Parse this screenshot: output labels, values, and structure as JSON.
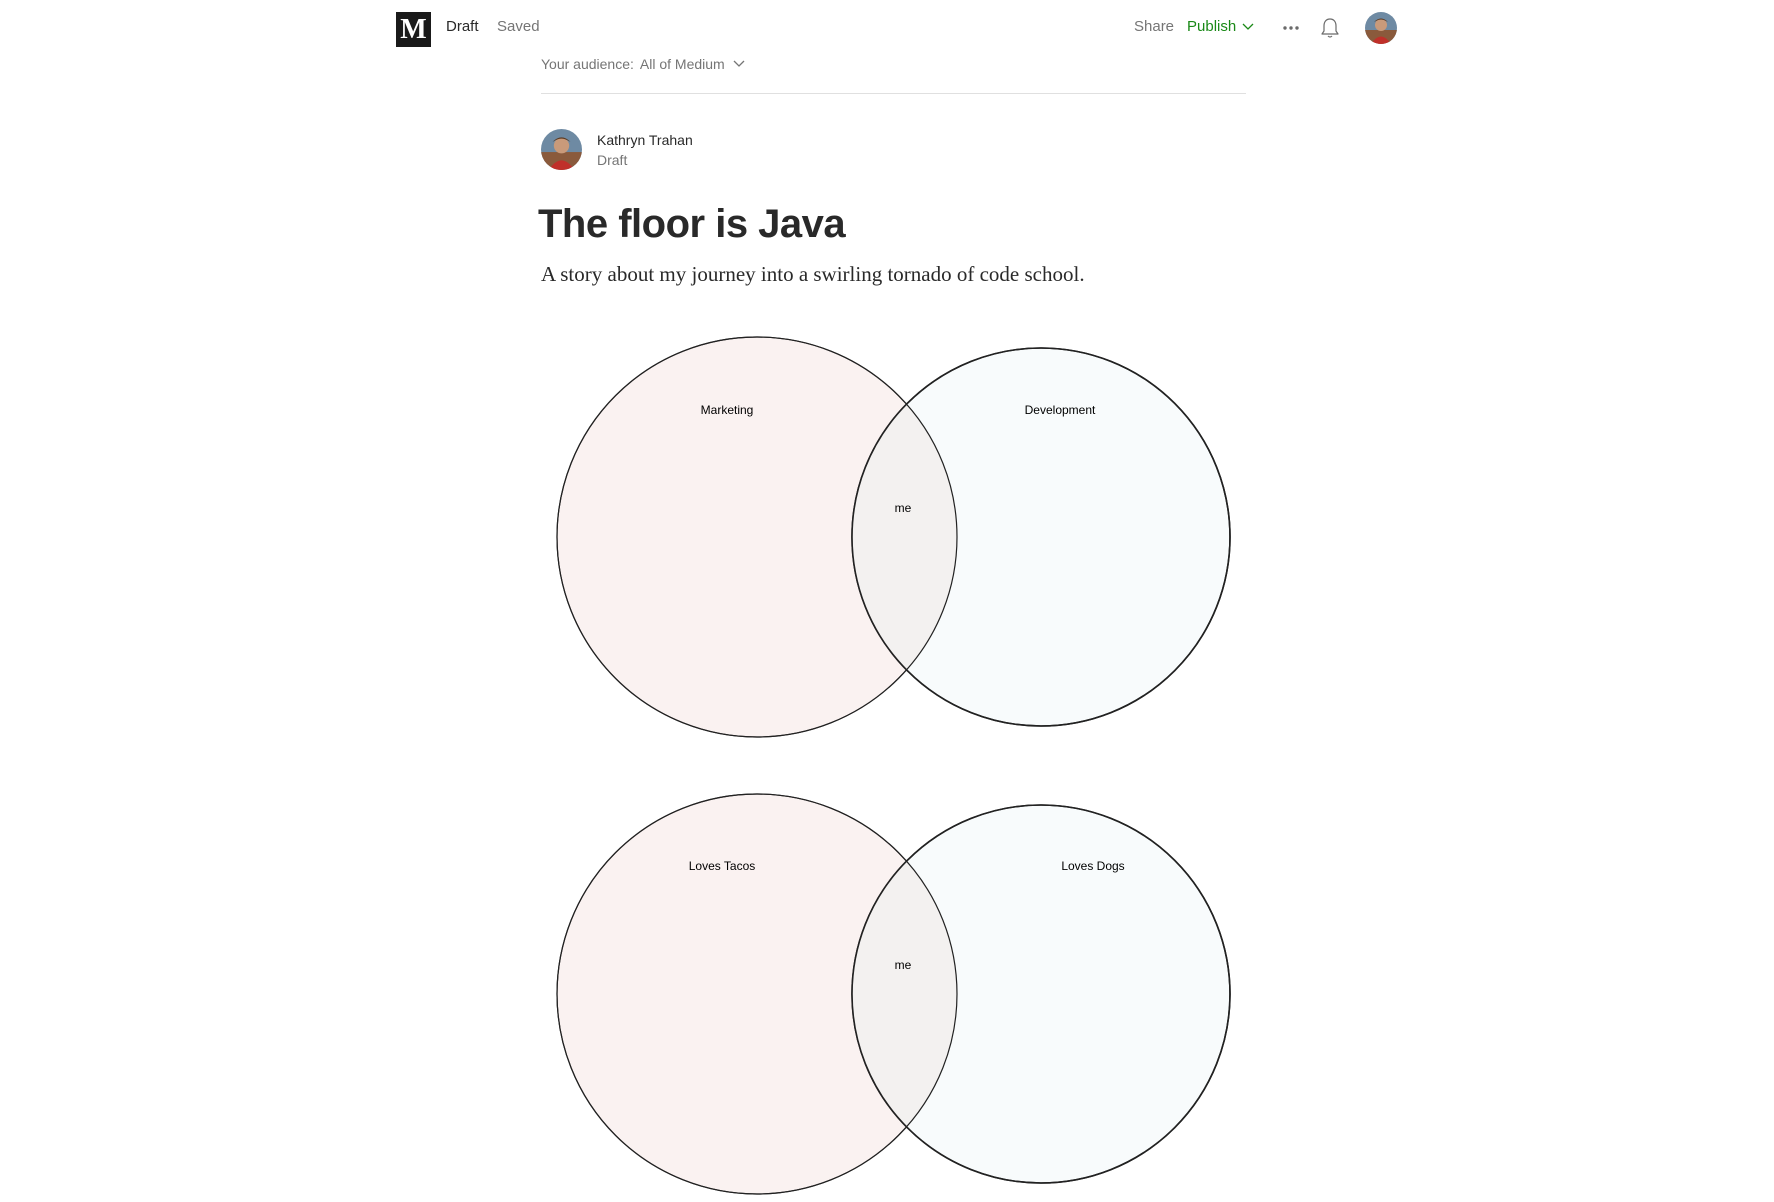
{
  "header": {
    "logo_label": "M",
    "status": "Draft",
    "save_state": "Saved",
    "share_label": "Share",
    "publish_label": "Publish",
    "icons": {
      "logo": "medium-logo-icon",
      "publish_dropdown": "chevron-down-icon",
      "more": "more-dots-icon",
      "notifications": "bell-icon",
      "profile": "avatar"
    }
  },
  "audience": {
    "label": "Your audience:",
    "value": "All of Medium"
  },
  "author": {
    "name": "Kathryn Trahan",
    "status": "Draft"
  },
  "post": {
    "title": "The floor is Java",
    "subtitle": "A story about my journey into a swirling tornado of code school."
  },
  "diagrams": [
    {
      "left_label": "Marketing",
      "right_label": "Development",
      "overlap_label": "me"
    },
    {
      "left_label": "Loves Tacos",
      "right_label": "Loves Dogs",
      "overlap_label": "me"
    }
  ],
  "colors": {
    "publish_accent": "#1a8917",
    "venn_left_fill": "#faf2f1",
    "venn_right_fill": "#f8fbfc",
    "venn_overlap_fill": "#f3f1f0"
  }
}
